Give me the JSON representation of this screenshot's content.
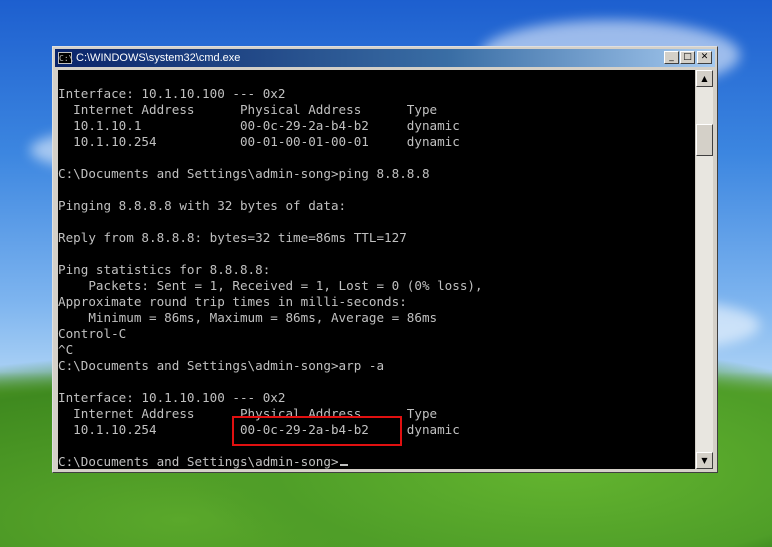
{
  "window": {
    "title": "C:\\WINDOWS\\system32\\cmd.exe",
    "app_icon_text": "C:\\",
    "min_glyph": "_",
    "max_glyph": "□",
    "close_glyph": "✕"
  },
  "console": {
    "lines": [
      "Interface: 10.1.10.100 --- 0x2",
      "  Internet Address      Physical Address      Type",
      "  10.1.10.1             00-0c-29-2a-b4-b2     dynamic",
      "  10.1.10.254           00-01-00-01-00-01     dynamic",
      "",
      "C:\\Documents and Settings\\admin-song>ping 8.8.8.8",
      "",
      "Pinging 8.8.8.8 with 32 bytes of data:",
      "",
      "Reply from 8.8.8.8: bytes=32 time=86ms TTL=127",
      "",
      "Ping statistics for 8.8.8.8:",
      "    Packets: Sent = 1, Received = 1, Lost = 0 (0% loss),",
      "Approximate round trip times in milli-seconds:",
      "    Minimum = 86ms, Maximum = 86ms, Average = 86ms",
      "Control-C",
      "^C",
      "C:\\Documents and Settings\\admin-song>arp -a",
      "",
      "Interface: 10.1.10.100 --- 0x2",
      "  Internet Address      Physical Address      Type",
      "  10.1.10.254           00-0c-29-2a-b4-b2     dynamic",
      "",
      "C:\\Documents and Settings\\admin-song>"
    ]
  },
  "scrollbar": {
    "up_glyph": "▲",
    "down_glyph": "▼"
  },
  "colors": {
    "console_bg": "#000000",
    "console_text": "#c0c0c0",
    "highlight_box": "#e01010",
    "titlebar_start": "#0a246a",
    "titlebar_end": "#a6caf0"
  }
}
